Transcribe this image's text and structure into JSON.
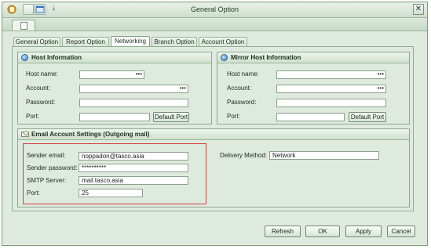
{
  "window": {
    "title": "General Option",
    "close_glyph": "✕"
  },
  "tabs": [
    "General Option",
    "Report Option",
    "Networking",
    "Branch Option",
    "Account Option"
  ],
  "host": {
    "title": "Host Information",
    "host_label": "Host name:",
    "account_label": "Account:",
    "password_label": "Password:",
    "port_label": "Port:",
    "ellipsis": "•••",
    "default_port": "Default Port"
  },
  "mirror": {
    "title": "Mirror Host Information",
    "host_label": "Host name:",
    "account_label": "Account:",
    "password_label": "Password:",
    "port_label": "Port:",
    "ellipsis": "•••",
    "default_port": "Default Port"
  },
  "email": {
    "title": "Email Account Settings (Outgoing mail)",
    "sender_email_label": "Sender email:",
    "sender_email_value": "noppadon@tasco.asia",
    "sender_password_label": "Sender password:",
    "sender_password_value": "**********",
    "smtp_label": "SMTP Server:",
    "smtp_value": "mail.tasco.asia",
    "port_label": "Port:",
    "port_value": "25",
    "delivery_label": "Delivery Method:",
    "delivery_value": "Network"
  },
  "buttons": {
    "refresh": "Refresh",
    "ok": "OK",
    "apply": "Apply",
    "cancel": "Cancel"
  },
  "caret": "⇣",
  "icons": {
    "app": "app-icon",
    "globe": "globe-icon",
    "mail": "mail-icon"
  }
}
